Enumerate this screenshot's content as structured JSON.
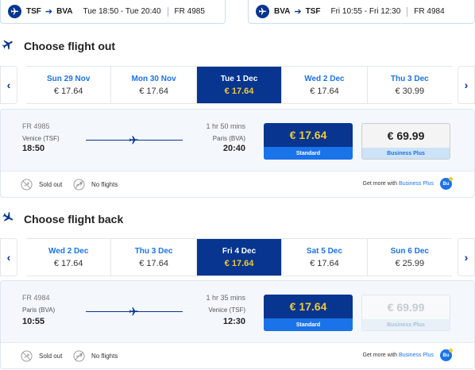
{
  "summary": {
    "outbound": {
      "from": "TSF",
      "to": "BVA",
      "time": "Tue 18:50 - Tue 20:40",
      "flight": "FR 4985"
    },
    "return": {
      "from": "BVA",
      "to": "TSF",
      "time": "Fri 10:55 - Fri 12:30",
      "flight": "FR 4984"
    }
  },
  "out": {
    "heading": "Choose flight out",
    "dates": [
      {
        "label": "Sun 29 Nov",
        "price": "€ 17.64"
      },
      {
        "label": "Mon 30 Nov",
        "price": "€ 17.64"
      },
      {
        "label": "Tue 1 Dec",
        "price": "€ 17.64"
      },
      {
        "label": "Wed 2 Dec",
        "price": "€ 17.64"
      },
      {
        "label": "Thu 3 Dec",
        "price": "€ 30.99"
      }
    ],
    "flight": {
      "number": "FR 4985",
      "dep_city": "Venice (TSF)",
      "dep_time": "18:50",
      "duration": "1 hr 50 mins",
      "arr_city": "Paris (BVA)",
      "arr_time": "20:40",
      "standard_price": "€ 17.64",
      "standard_label": "Standard",
      "plus_price": "€ 69.99",
      "plus_label": "Business Plus"
    }
  },
  "back": {
    "heading": "Choose flight back",
    "dates": [
      {
        "label": "Wed 2 Dec",
        "price": "€ 17.64"
      },
      {
        "label": "Thu 3 Dec",
        "price": "€ 17.64"
      },
      {
        "label": "Fri 4 Dec",
        "price": "€ 17.64"
      },
      {
        "label": "Sat 5 Dec",
        "price": "€ 17.64"
      },
      {
        "label": "Sun 6 Dec",
        "price": "€ 25.99"
      }
    ],
    "flight": {
      "number": "FR 4984",
      "dep_city": "Paris (BVA)",
      "dep_time": "10:55",
      "duration": "1 hr 35 mins",
      "arr_city": "Venice (TSF)",
      "arr_time": "12:30",
      "standard_price": "€ 17.64",
      "standard_label": "Standard",
      "plus_price": "€ 69.99",
      "plus_label": "Business Plus"
    }
  },
  "legend": {
    "sold_out": "Sold out",
    "no_flights": "No flights",
    "get_more": "Get more with",
    "business_plus": "Business Plus",
    "badge": "Bu"
  },
  "carousel": {
    "prev_icon": "‹",
    "next_icon": "›"
  },
  "colors": {
    "primary": "#073590",
    "accent": "#1a73e8",
    "price_yellow": "#f1c933"
  }
}
